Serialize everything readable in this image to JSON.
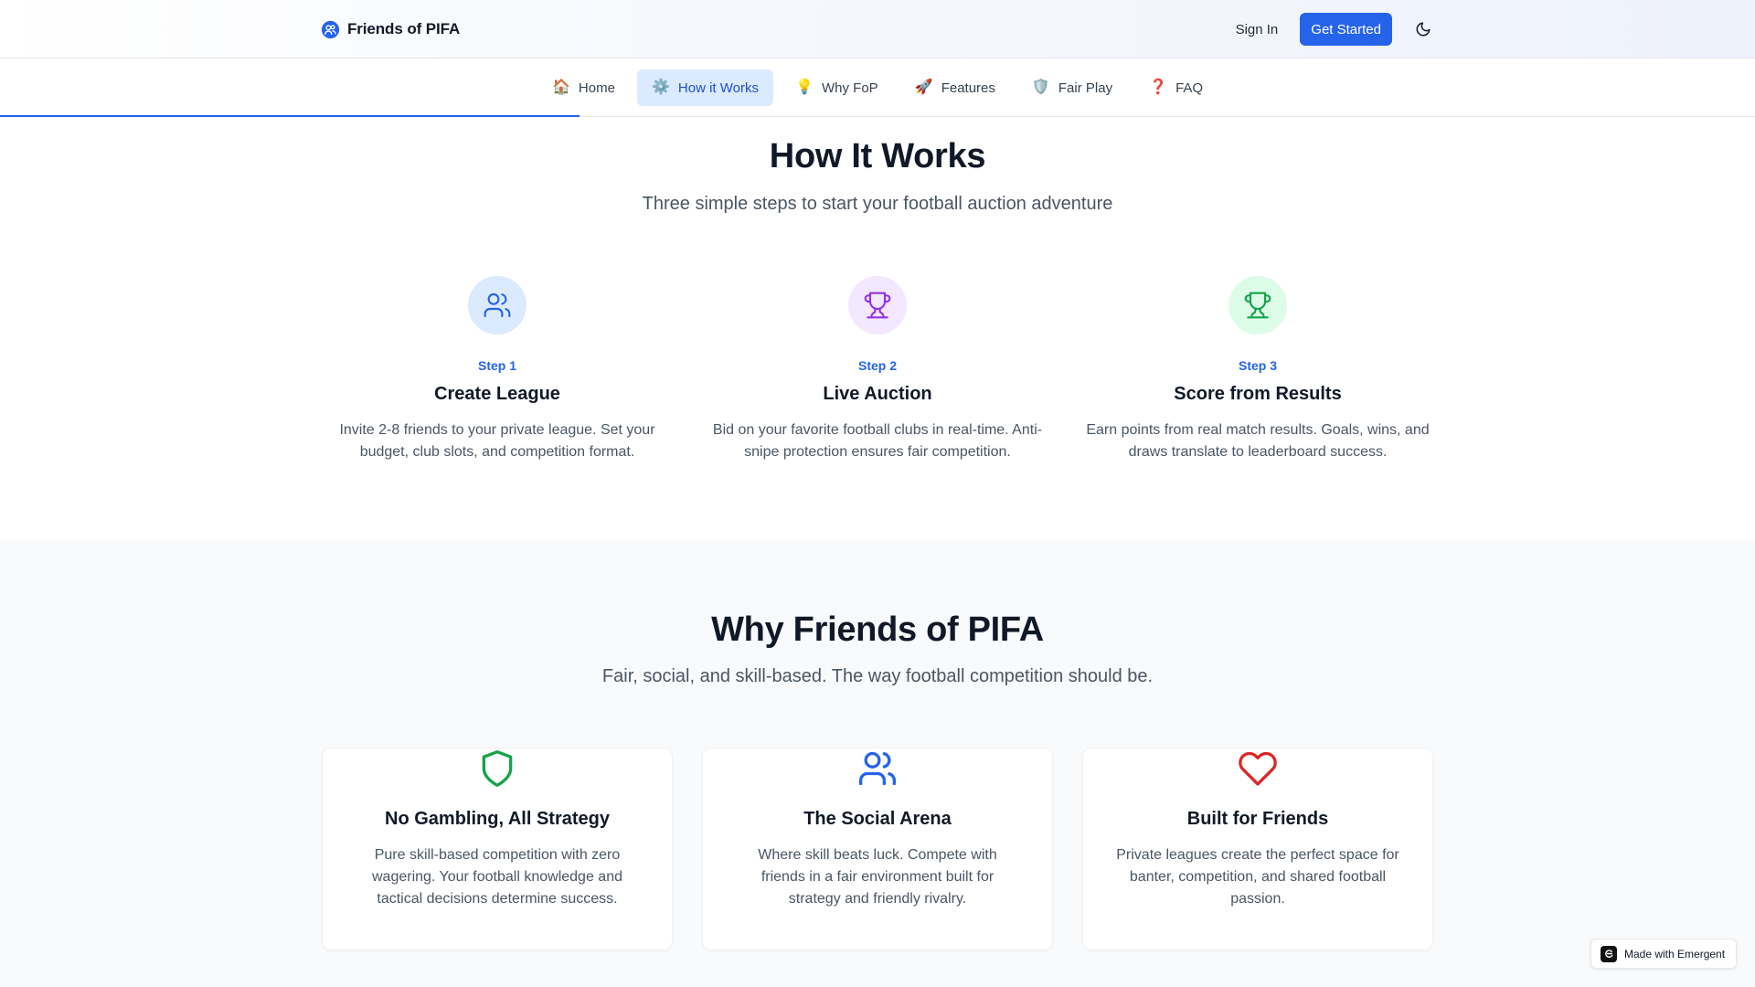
{
  "header": {
    "brand": "Friends of PIFA",
    "sign_in": "Sign In",
    "get_started": "Get Started",
    "theme_icon": "moon-icon"
  },
  "nav": {
    "tabs": [
      {
        "icon": "🏠",
        "label": "Home",
        "active": false
      },
      {
        "icon": "⚙️",
        "label": "How it Works",
        "active": true
      },
      {
        "icon": "💡",
        "label": "Why FoP",
        "active": false
      },
      {
        "icon": "🚀",
        "label": "Features",
        "active": false
      },
      {
        "icon": "🛡️",
        "label": "Fair Play",
        "active": false
      },
      {
        "icon": "❓",
        "label": "FAQ",
        "active": false
      }
    ],
    "scroll_progress_percent": 33
  },
  "how": {
    "title": "How It Works",
    "subtitle": "Three simple steps to start your football auction adventure",
    "steps": [
      {
        "step": "Step 1",
        "title": "Create League",
        "desc": "Invite 2-8 friends to your private league. Set your budget, club slots, and competition format.",
        "icon": "users-icon",
        "bg": "#dbeafe",
        "color": "#2563eb"
      },
      {
        "step": "Step 2",
        "title": "Live Auction",
        "desc": "Bid on your favorite football clubs in real-time. Anti-snipe protection ensures fair competition.",
        "icon": "trophy-icon",
        "bg": "#f3e8ff",
        "color": "#9333ea"
      },
      {
        "step": "Step 3",
        "title": "Score from Results",
        "desc": "Earn points from real match results. Goals, wins, and draws translate to leaderboard success.",
        "icon": "trophy-icon",
        "bg": "#dcfce7",
        "color": "#16a34a"
      }
    ]
  },
  "why": {
    "title": "Why Friends of PIFA",
    "subtitle": "Fair, social, and skill-based. The way football competition should be.",
    "cards": [
      {
        "title": "No Gambling, All Strategy",
        "desc": "Pure skill-based competition with zero wagering. Your football knowledge and tactical decisions determine success.",
        "icon": "shield-icon",
        "color": "#16a34a"
      },
      {
        "title": "The Social Arena",
        "desc": "Where skill beats luck. Compete with friends in a fair environment built for strategy and friendly rivalry.",
        "icon": "users-icon",
        "color": "#2563eb"
      },
      {
        "title": "Built for Friends",
        "desc": "Private leagues create the perfect space for banter, competition, and shared football passion.",
        "icon": "heart-icon",
        "color": "#dc2626"
      }
    ]
  },
  "badge": {
    "text": "Made with Emergent"
  }
}
